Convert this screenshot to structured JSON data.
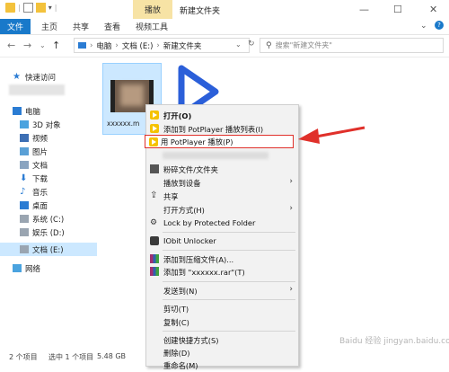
{
  "titlebar": {
    "context_tab": "播放",
    "window_title": "新建文件夹",
    "minimize": "—",
    "maximize": "☐",
    "close": "✕"
  },
  "ribbon": {
    "tabs": [
      "文件",
      "主页",
      "共享",
      "查看",
      "视频工具"
    ]
  },
  "address": {
    "path": [
      "电脑",
      "文档 (E:)",
      "新建文件夹"
    ],
    "search_placeholder": "搜索\"新建文件夹\""
  },
  "nav": {
    "items": [
      {
        "label": "快速访问",
        "icon": "star-icon"
      },
      {
        "label": "电脑",
        "icon": "pc-icon"
      },
      {
        "label": "3D 对象",
        "icon": "cube-icon"
      },
      {
        "label": "视频",
        "icon": "video-folder-icon"
      },
      {
        "label": "图片",
        "icon": "picture-folder-icon"
      },
      {
        "label": "文档",
        "icon": "document-folder-icon"
      },
      {
        "label": "下载",
        "icon": "download-icon"
      },
      {
        "label": "音乐",
        "icon": "music-icon"
      },
      {
        "label": "桌面",
        "icon": "desktop-icon"
      },
      {
        "label": "系统 (C:)",
        "icon": "drive-icon"
      },
      {
        "label": "娱乐 (D:)",
        "icon": "drive-icon"
      },
      {
        "label": "文档 (E:)",
        "icon": "drive-icon"
      },
      {
        "label": "网络",
        "icon": "network-icon"
      }
    ]
  },
  "files": [
    {
      "name": "xxxxxx.m",
      "icon": "video-thumbnail"
    }
  ],
  "status": {
    "count": "2 个项目",
    "selected": "选中 1 个项目",
    "size": "5.48 GB"
  },
  "context_menu": {
    "items": [
      {
        "label": "打开(O)",
        "icon": "potplayer-icon",
        "bold": true
      },
      {
        "label": "添加到 PotPlayer 播放列表(I)",
        "icon": "potplayer-icon"
      },
      {
        "label": "用 PotPlayer 播放(P)",
        "icon": "potplayer-icon",
        "highlighted": true
      },
      {
        "label": "粉碎文件/文件夹",
        "icon": "shred-icon"
      },
      {
        "label": "播放到设备",
        "submenu": true
      },
      {
        "label": "共享",
        "icon": "share-icon"
      },
      {
        "label": "打开方式(H)",
        "submenu": true
      },
      {
        "label": "Lock by Protected Folder",
        "icon": "lock-icon"
      },
      {
        "label": "IObit Unlocker",
        "icon": "unlocker-icon"
      },
      {
        "label": "添加到压缩文件(A)...",
        "icon": "winrar-icon"
      },
      {
        "label": "添加到 \"xxxxxx.rar\"(T)",
        "icon": "winrar-icon"
      },
      {
        "label": "发送到(N)",
        "submenu": true
      },
      {
        "label": "剪切(T)"
      },
      {
        "label": "复制(C)"
      },
      {
        "label": "创建快捷方式(S)"
      },
      {
        "label": "删除(D)"
      },
      {
        "label": "重命名(M)"
      }
    ]
  },
  "colors": {
    "accent": "#1979ca",
    "highlight_border": "#e0302a",
    "arrow": "#e0302a",
    "selection": "#cce8ff",
    "potplayer": "#f5c200"
  },
  "watermark": "Baidu 经验 jingyan.baidu.com"
}
